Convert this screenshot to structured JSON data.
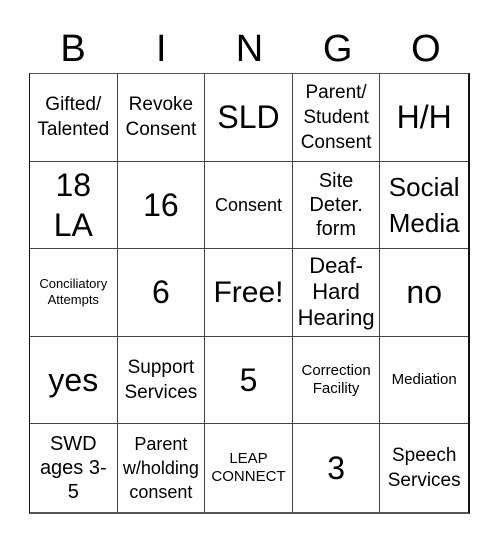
{
  "header": {
    "letters": [
      "B",
      "I",
      "N",
      "G",
      "O"
    ]
  },
  "cells": [
    {
      "text": "Gifted/\nTalented",
      "size": "s19"
    },
    {
      "text": "Revoke\nConsent",
      "size": "s19"
    },
    {
      "text": "SLD",
      "size": "s32"
    },
    {
      "text": "Parent/\nStudent\nConsent",
      "size": "s19"
    },
    {
      "text": "H/H",
      "size": "s32"
    },
    {
      "text": "18\nLA",
      "size": "s32"
    },
    {
      "text": "16",
      "size": "s32"
    },
    {
      "text": "Consent",
      "size": "s18"
    },
    {
      "text": "Site\nDeter.\nform",
      "size": "s20"
    },
    {
      "text": "Social\nMedia",
      "size": "s26"
    },
    {
      "text": "Conciliatory\nAttempts",
      "size": "s13"
    },
    {
      "text": "6",
      "size": "s32"
    },
    {
      "text": "Free!",
      "size": "s29"
    },
    {
      "text": "Deaf-\nHard\nHearing",
      "size": "s22"
    },
    {
      "text": "no",
      "size": "s32"
    },
    {
      "text": "yes",
      "size": "s32"
    },
    {
      "text": "Support\nServices",
      "size": "s19"
    },
    {
      "text": "5",
      "size": "s32"
    },
    {
      "text": "Correction\nFacility",
      "size": "s15"
    },
    {
      "text": "Mediation",
      "size": "s15"
    },
    {
      "text": "SWD\nages 3-\n5",
      "size": "s20"
    },
    {
      "text": "Parent\nw/holding\nconsent",
      "size": "s18"
    },
    {
      "text": "LEAP\nCONNECT",
      "size": "s15"
    },
    {
      "text": "3",
      "size": "s32"
    },
    {
      "text": "Speech\nServices",
      "size": "s19"
    }
  ]
}
